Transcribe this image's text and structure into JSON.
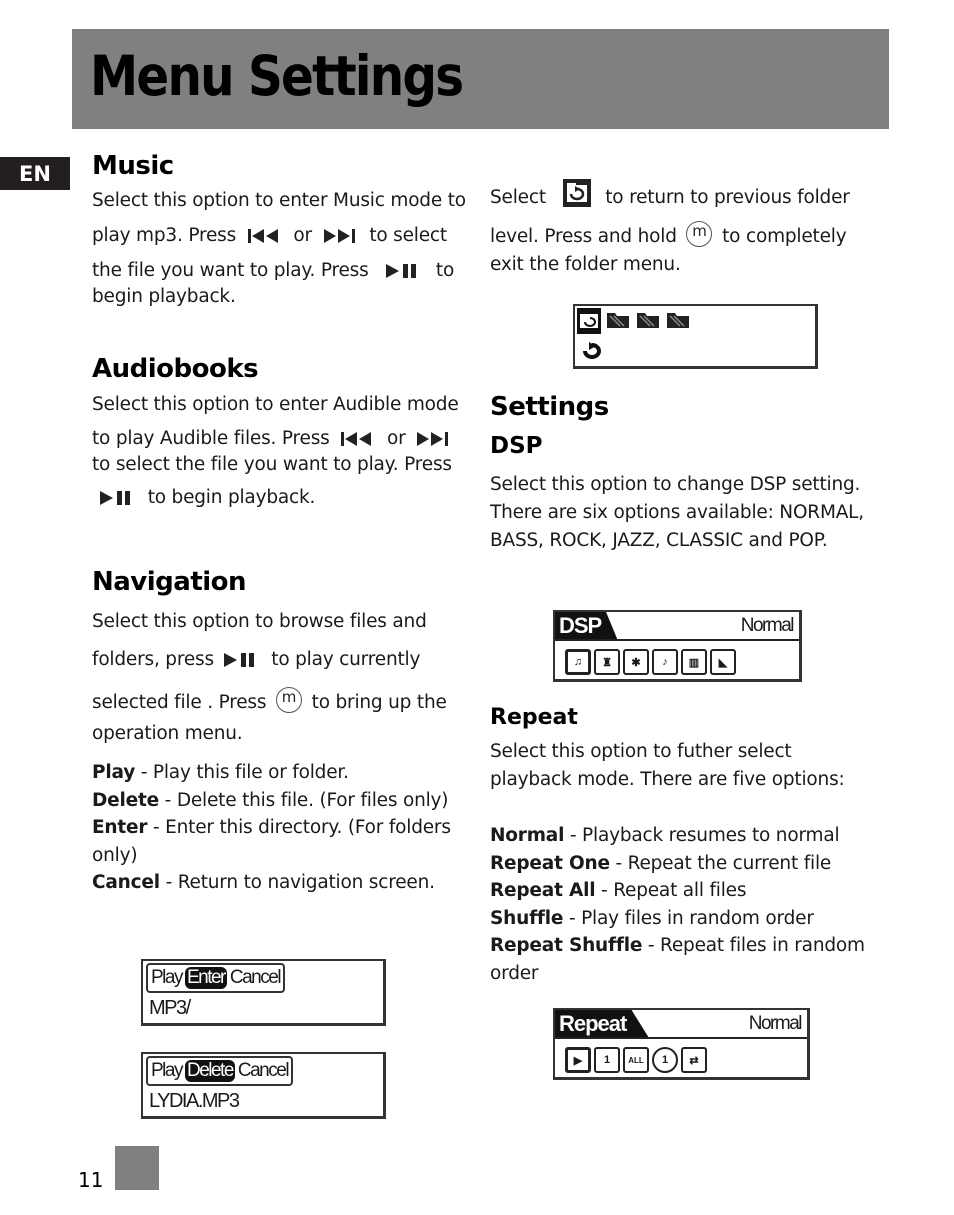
{
  "header": {
    "title": "Menu Settings"
  },
  "language_tab": "EN",
  "music": {
    "heading": "Music",
    "line1": "Select this option to enter Music mode to",
    "line2_a": "play mp3. Press",
    "line2_or": "or",
    "line2_b": "to select",
    "line3_a": "the file you want to play. Press",
    "line3_b": "to",
    "line4": "begin playback."
  },
  "audiobooks": {
    "heading": "Audiobooks",
    "line1": "Select this option to enter Audible mode",
    "line2_a": "to play Audible files. Press",
    "line2_or": "or",
    "line3": "to select the file you want to play. Press",
    "line4": "to begin playback."
  },
  "navigation": {
    "heading": "Navigation",
    "line1": "Select this option to browse files and",
    "line2_a": "folders, press",
    "line2_b": "to play currently",
    "line3_a": "selected file . Press",
    "line3_b": "to bring up the",
    "line4": "operation menu.",
    "options": [
      {
        "term": "Play",
        "desc": " - Play this file or folder."
      },
      {
        "term": "Delete",
        "desc": " - Delete this file. (For files only)"
      },
      {
        "term": "Enter",
        "desc": " - Enter this directory. (For folders"
      },
      {
        "term": "",
        "desc": "only)"
      },
      {
        "term": "Cancel",
        "desc": " - Return to navigation screen."
      }
    ],
    "screens": [
      {
        "menu": [
          "Play",
          "Enter",
          "Cancel"
        ],
        "selected": "Enter",
        "file": "MP3/"
      },
      {
        "menu": [
          "Play",
          "Delete",
          "Cancel"
        ],
        "selected": "Delete",
        "file": "LYDIA.MP3"
      }
    ]
  },
  "folder_return": {
    "line1_a": "Select",
    "line1_b": "to return to previous folder",
    "line2_a": "level. Press and hold",
    "line2_b": "to completely",
    "line3": "exit the folder menu."
  },
  "m_button": "m",
  "settings": {
    "heading": "Settings",
    "dsp": {
      "heading": "DSP",
      "lines": [
        "Select this option to change DSP setting.",
        "There are six options available: NORMAL,",
        "BASS, ROCK, JAZZ, CLASSIC and POP."
      ],
      "screen": {
        "tab": "DSP",
        "value": "Normal",
        "icons": [
          "normal-eq-icon",
          "bass-icon",
          "rock-icon",
          "jazz-icon",
          "classic-icon",
          "pop-icon"
        ]
      }
    },
    "repeat": {
      "heading": "Repeat",
      "lines": [
        "Select this option to futher select",
        "playback mode. There are five options:"
      ],
      "options": [
        {
          "term": "Normal",
          "desc": " - Playback resumes to normal"
        },
        {
          "term": "Repeat One",
          "desc": " - Repeat the current file"
        },
        {
          "term": "Repeat All",
          "desc": " - Repeat all files"
        },
        {
          "term": "Shuffle",
          "desc": " - Play files in random order"
        },
        {
          "term": "Repeat Shuffle",
          "desc": " - Repeat files in random"
        },
        {
          "term": "",
          "desc": "order"
        }
      ],
      "screen": {
        "tab": "Repeat",
        "value": "Normal",
        "icon_labels": [
          "▶",
          "1",
          "ALL",
          "1",
          "⇄"
        ]
      }
    }
  },
  "footer": {
    "page_number": "11"
  }
}
